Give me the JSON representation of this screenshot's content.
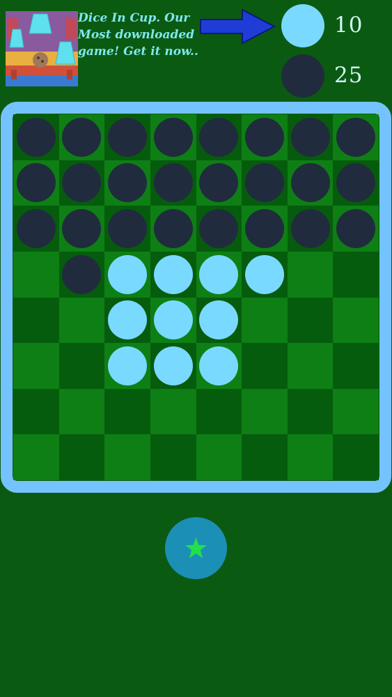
{
  "ad": {
    "text": "Dice In Cup. Our Most downloaded game! Get it now..",
    "thumbnail_icon": "dice-in-cup-game-thumbnail",
    "arrow_icon": "blue-arrow-right-icon"
  },
  "scores": {
    "light": {
      "value": "10",
      "color": "#7ad9ff"
    },
    "dark": {
      "value": "25",
      "color": "#202c3d"
    },
    "current_turn": "light"
  },
  "board": {
    "size": 8,
    "colors": {
      "frame": "#74c3ff",
      "light_square": "#0e7f14",
      "dark_square": "#065c0d",
      "light_piece": "#7ad9ff",
      "dark_piece": "#202c3d"
    },
    "cells": [
      "BBBBBBBB",
      "BBBBBBBB",
      "BBBBBBBB",
      ".BWWWW..",
      "..WWW...",
      "..WWW...",
      "........",
      "........"
    ]
  },
  "hint_button": {
    "icon": "star-icon",
    "color": "#1b8fb6",
    "star_color": "#22e04a"
  },
  "background_color": "#0b5a12"
}
